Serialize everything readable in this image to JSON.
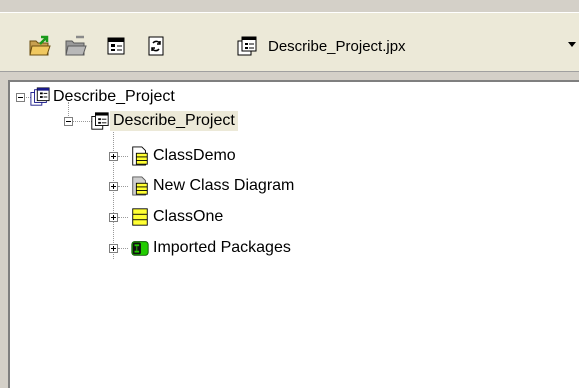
{
  "toolbar": {
    "buttons": [
      {
        "name": "open-folder-icon"
      },
      {
        "name": "close-project-icon"
      },
      {
        "name": "project-properties-icon"
      },
      {
        "name": "refresh-icon"
      }
    ],
    "project_selector": {
      "value": "Describe_Project.jpx"
    }
  },
  "tree": {
    "root": {
      "label": "Describe_Project",
      "expanded": true
    },
    "project": {
      "label": "Describe_Project",
      "expanded": true,
      "selected": true
    },
    "children": [
      {
        "label": "ClassDemo",
        "icon": "class-diagram-icon"
      },
      {
        "label": "New Class Diagram",
        "icon": "class-diagram-icon"
      },
      {
        "label": "ClassOne",
        "icon": "class-icon"
      },
      {
        "label": "Imported Packages",
        "icon": "package-icon"
      }
    ]
  },
  "colors": {
    "background": "#d4d0c8",
    "toolbar": "#ece9d8",
    "tree_background": "#ffffff",
    "selection": "#ece9d8",
    "class_yellow": "#ffff33",
    "package_green": "#22cc00"
  }
}
